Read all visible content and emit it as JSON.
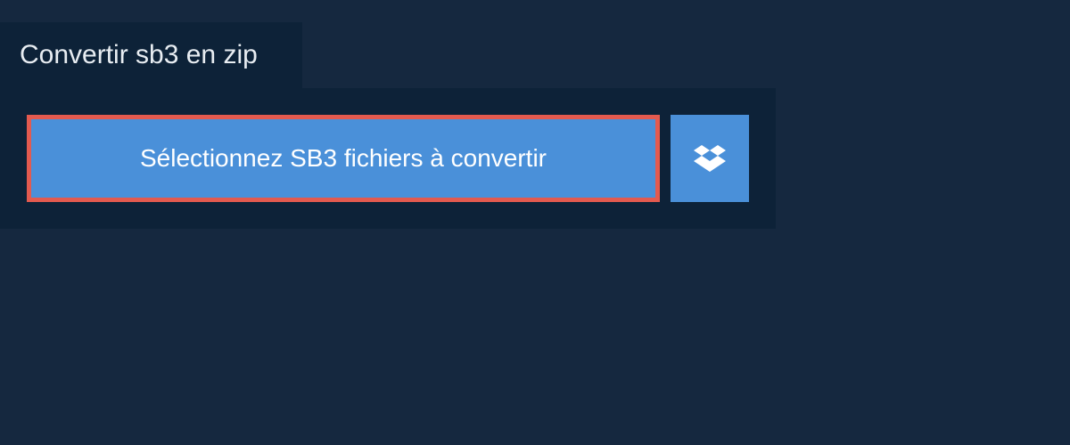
{
  "tab": {
    "title": "Convertir sb3 en zip"
  },
  "buttons": {
    "select_label": "Sélectionnez SB3 fichiers à convertir"
  },
  "colors": {
    "background_dark": "#15283f",
    "panel_dark": "#0d2238",
    "button_blue": "#4a90d9",
    "highlight_red": "#e35a4f",
    "text_light": "#e8edf2",
    "text_white": "#ffffff"
  }
}
